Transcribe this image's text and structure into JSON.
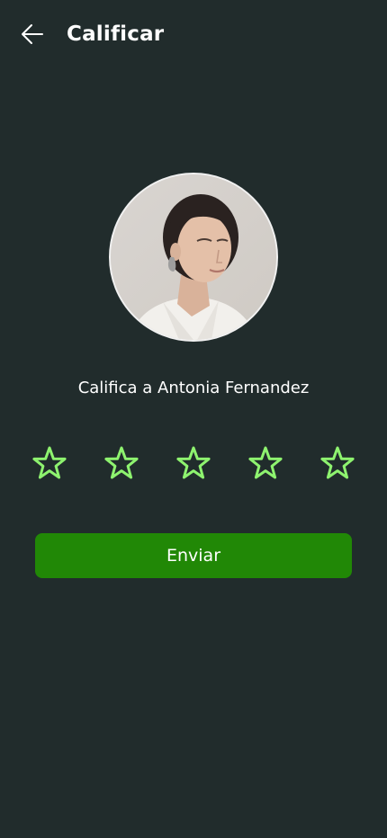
{
  "header": {
    "back_icon": "arrow-left-icon",
    "title": "Calificar"
  },
  "profile": {
    "avatar_description_icon": "avatar-photo",
    "rate_label": "Califica a Antonia Fernandez"
  },
  "rating": {
    "max": 5,
    "value": 0,
    "star_icon": "star-outline-icon",
    "star_color": "#8ef36f"
  },
  "actions": {
    "submit_label": "Enviar"
  },
  "colors": {
    "background": "#212c2c",
    "primary_button": "#218806",
    "text": "#ffffff"
  }
}
